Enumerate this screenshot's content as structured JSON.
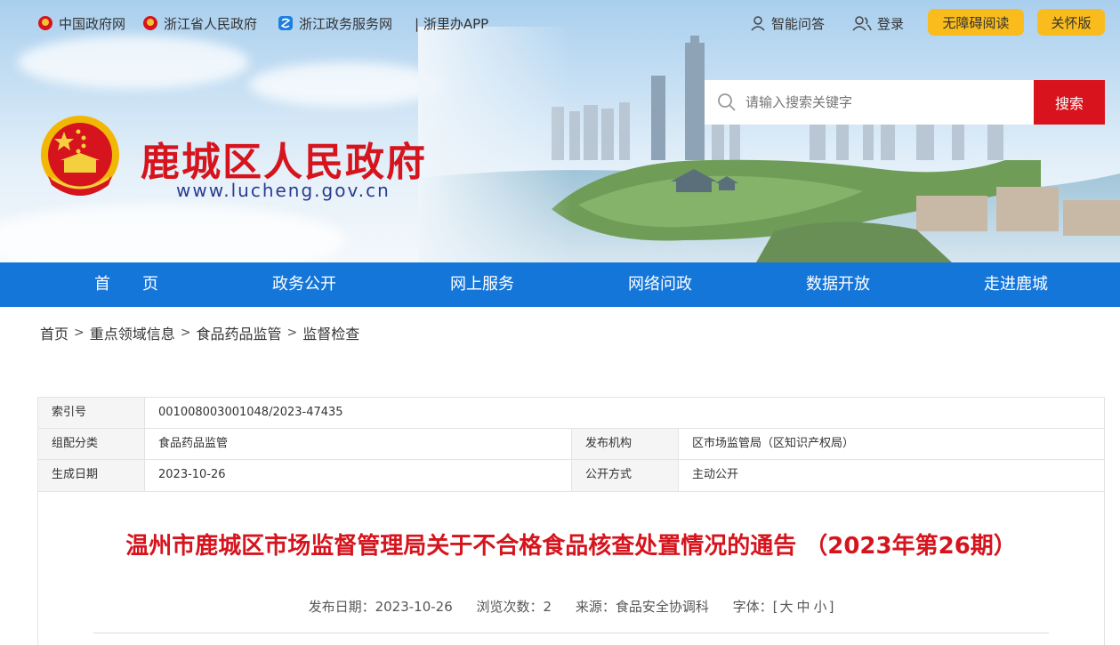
{
  "topbar": {
    "links": [
      {
        "label": "中国政府网",
        "icon": "emblem-icon"
      },
      {
        "label": "浙江省人民政府",
        "icon": "emblem-icon"
      },
      {
        "label": "浙江政务服务网",
        "icon": "zjzw-icon"
      },
      {
        "label": "| 浙里办APP",
        "icon": ""
      }
    ],
    "smart_qa": "智能问答",
    "login": "登录",
    "accessible_read": "无障碍阅读",
    "care_version": "关怀版"
  },
  "header": {
    "site_title": "鹿城区人民政府",
    "site_url": "www.lucheng.gov.cn"
  },
  "search": {
    "placeholder": "请输入搜索关键字",
    "button": "搜索"
  },
  "nav": {
    "items": [
      "首　　页",
      "政务公开",
      "网上服务",
      "网络问政",
      "数据开放",
      "走进鹿城"
    ]
  },
  "breadcrumb": {
    "items": [
      "首页",
      "重点领域信息",
      "食品药品监管",
      "监督检查"
    ],
    "separator": ">"
  },
  "info": {
    "index_no_label": "索引号",
    "index_no": "001008003001048/2023-47435",
    "category_label": "组配分类",
    "category": "食品药品监管",
    "publisher_label": "发布机构",
    "publisher": "区市场监管局（区知识产权局）",
    "date_label": "生成日期",
    "date": "2023-10-26",
    "open_mode_label": "公开方式",
    "open_mode": "主动公开"
  },
  "article": {
    "title": "温州市鹿城区市场监督管理局关于不合格食品核查处置情况的通告 （2023年第26期）",
    "publish_date": "发布日期：2023-10-26",
    "views": "浏览次数：2",
    "source": "来源：食品安全协调科",
    "font_label": "字体：[",
    "font_large": "大",
    "font_medium": "中",
    "font_small": "小",
    "font_close": "]"
  },
  "colors": {
    "brand_red": "#d6141d",
    "nav_blue": "#1576da",
    "button_yellow": "#f9bc1c"
  }
}
